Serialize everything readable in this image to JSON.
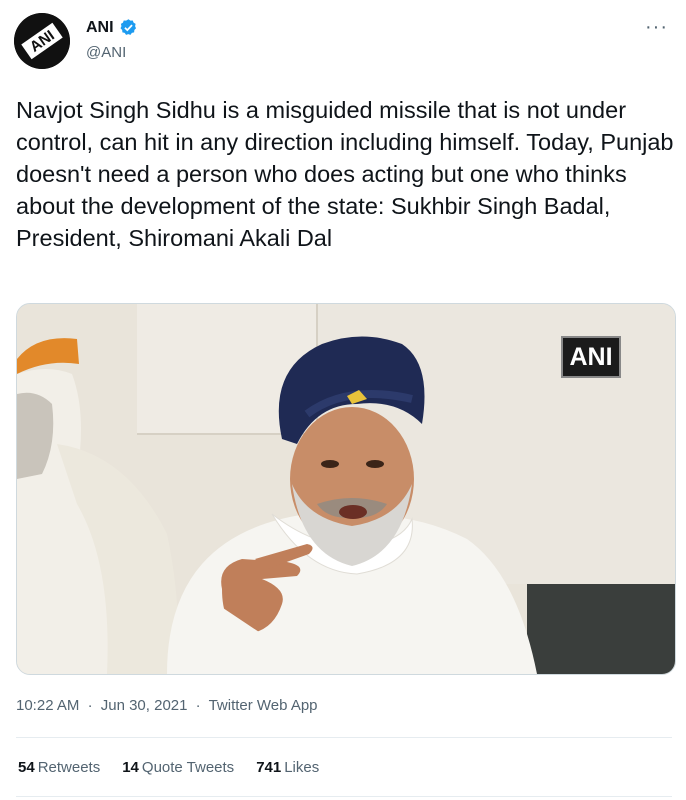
{
  "author": {
    "name": "ANI",
    "handle": "@ANI",
    "avatar_text": "ANI",
    "verified_icon": "verified-badge-icon",
    "verified_color": "#1d9bf0"
  },
  "menu_icon": "more-options-icon",
  "tweet": {
    "text": "Navjot Singh Sidhu is a misguided missile that is not under control, can hit in any direction including himself. Today, Punjab doesn't need a person who does acting but one who thinks about the development of the state: Sukhbir Singh Badal, President, Shiromani Akali Dal",
    "media_watermark": "ANI"
  },
  "meta": {
    "time": "10:22 AM",
    "date": "Jun 30, 2021",
    "source": "Twitter Web App",
    "separator": "·"
  },
  "stats": {
    "retweets_count": "54",
    "retweets_label": "Retweets",
    "quotes_count": "14",
    "quotes_label": "Quote Tweets",
    "likes_count": "741",
    "likes_label": "Likes"
  }
}
